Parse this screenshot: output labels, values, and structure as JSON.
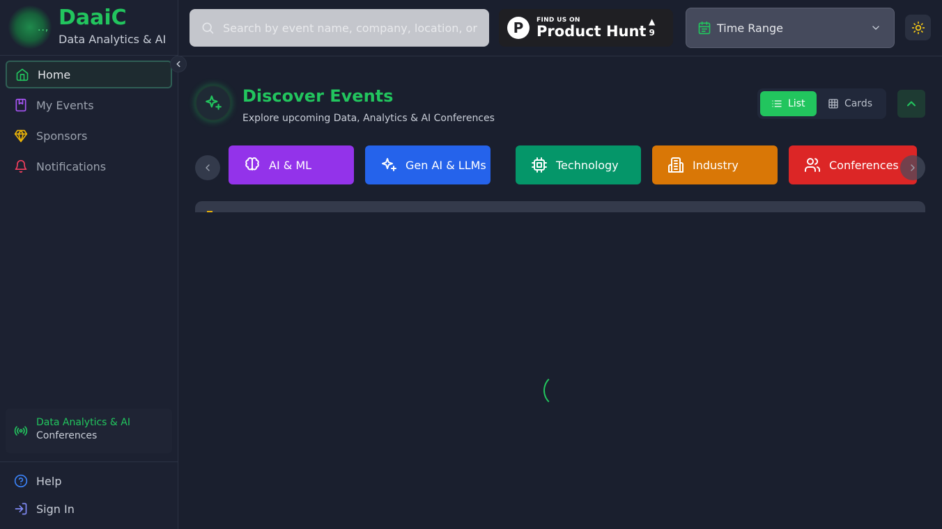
{
  "brand": {
    "name": "DaaiC",
    "subtitle": "Data Analytics & AI",
    "logo_dots": "..,"
  },
  "sidebar": {
    "items": [
      {
        "label": "Home",
        "icon": "home-icon",
        "active": true
      },
      {
        "label": "My Events",
        "icon": "bookmark-icon",
        "active": false
      },
      {
        "label": "Sponsors",
        "icon": "gem-icon",
        "active": false
      },
      {
        "label": "Notifications",
        "icon": "bell-icon",
        "active": false
      }
    ],
    "promo": {
      "line1": "Data Analytics & AI",
      "line2": "Conferences",
      "icon": "broadcast-icon"
    },
    "bottom": [
      {
        "label": "Help",
        "icon": "help-circle-icon"
      },
      {
        "label": "Sign In",
        "icon": "sign-in-icon"
      }
    ]
  },
  "topbar": {
    "search_placeholder": "Search by event name, company, location, or",
    "product_hunt": {
      "small": "FIND US ON",
      "big": "Product Hunt",
      "logo": "P",
      "arrow": "▲",
      "votes": "9"
    },
    "time_range_label": "Time Range"
  },
  "main": {
    "title": "Discover Events",
    "subtitle": "Explore upcoming Data, Analytics & AI Conferences",
    "view_toggle": {
      "list": "List",
      "cards": "Cards",
      "active": "list"
    },
    "categories": [
      {
        "label": "AI & ML",
        "color": "#9333ea",
        "icon": "brain-icon"
      },
      {
        "label": "Gen AI & LLMs",
        "color": "#2563eb",
        "icon": "sparkles-icon"
      },
      {
        "label": "Technology",
        "color": "#059669",
        "icon": "cpu-icon"
      },
      {
        "label": "Industry",
        "color": "#d97706",
        "icon": "building-icon"
      },
      {
        "label": "Conferences",
        "color": "#dc2626",
        "icon": "users-icon"
      }
    ]
  },
  "colors": {
    "accent": "#22c55e",
    "background": "#1a1f2e",
    "sidebar": "#1c2131"
  }
}
